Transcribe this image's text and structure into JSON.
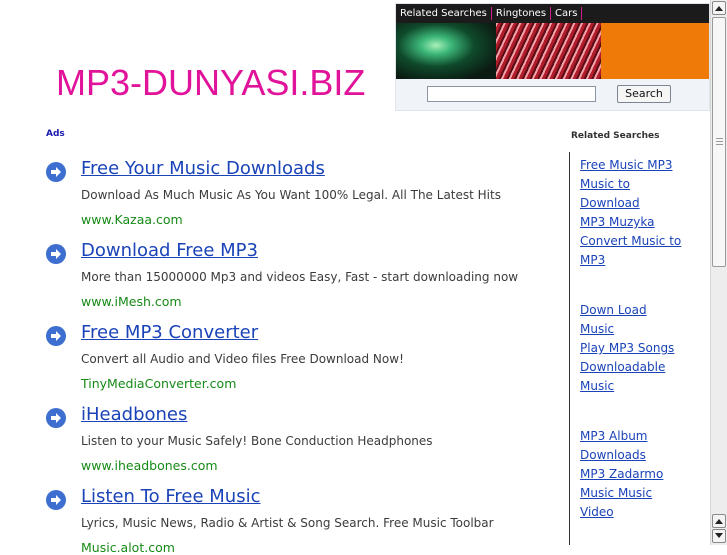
{
  "site": {
    "title": "MP3-DUNYASI.BIZ"
  },
  "nav": {
    "links": [
      "Related Searches",
      "Ringtones",
      "Cars"
    ]
  },
  "search": {
    "value": "",
    "button_label": "Search"
  },
  "ads": {
    "label": "Ads",
    "items": [
      {
        "title": "Free Your Music Downloads",
        "description": "Download As Much Music As You Want 100% Legal. All The Latest Hits",
        "url": "www.Kazaa.com"
      },
      {
        "title": "Download Free MP3",
        "description": "More than 15000000 Mp3 and videos Easy, Fast - start downloading now",
        "url": "www.iMesh.com"
      },
      {
        "title": "Free MP3 Converter",
        "description": "Convert all Audio and Video files Free Download Now!",
        "url": "TinyMediaConverter.com"
      },
      {
        "title": "iHeadbones",
        "description": "Listen to your Music Safely! Bone Conduction Headphones",
        "url": "www.iheadbones.com"
      },
      {
        "title": "Listen To Free Music",
        "description": "Lyrics, Music News, Radio & Artist & Song Search. Free Music Toolbar",
        "url": "Music.alot.com"
      }
    ]
  },
  "related": {
    "header": "Related Searches",
    "lines": [
      "Free Music MP3",
      "Music to",
      "Download",
      "MP3 Muzyka",
      "Convert Music to",
      "MP3",
      "Down Load",
      "Music",
      "Play MP3 Songs",
      "Downloadable",
      "Music",
      "MP3 Album",
      "Downloads",
      "MP3 Zadarmo",
      "Music Music",
      "Video"
    ]
  },
  "colors": {
    "title": "#e0139a",
    "link": "#1a43b8",
    "url": "#168a16",
    "banner_orange": "#f07a08"
  },
  "icons": {
    "ad_bullet": "arrow-right-circle-icon",
    "scroll_up": "scroll-up-icon",
    "scroll_down": "scroll-down-icon"
  }
}
